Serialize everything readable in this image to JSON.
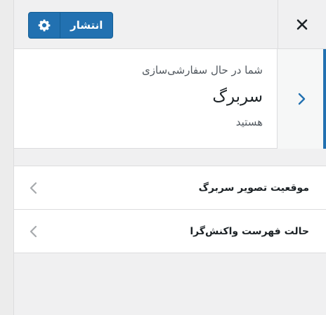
{
  "header": {
    "publish_label": "انتشار",
    "settings_icon": "gear-icon",
    "close_icon": "close-icon"
  },
  "info": {
    "pre_text": "شما در حال سفارشی‌سازی",
    "title": "سربرگ",
    "post_text": "هستید",
    "back_icon": "chevron-right-icon"
  },
  "sections": [
    {
      "label": "موقعیت تصویر سربرگ",
      "icon": "chevron-left-icon"
    },
    {
      "label": "حالت فهرست واکنش‌گرا",
      "icon": "chevron-left-icon"
    }
  ],
  "colors": {
    "accent": "#2271b1",
    "accent_border": "#135e96",
    "background": "#f0f0f1",
    "panel": "#ffffff",
    "text": "#1d2327",
    "muted": "#50575e",
    "border": "#dcdcde"
  }
}
